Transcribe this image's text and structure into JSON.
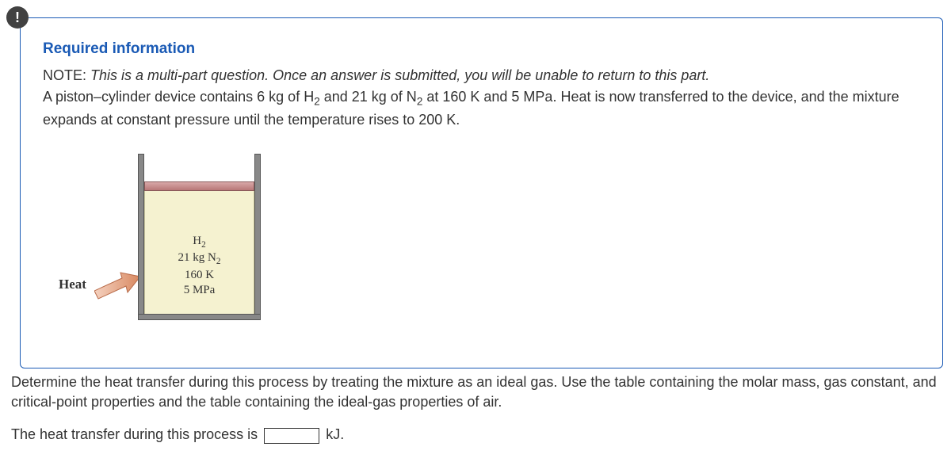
{
  "alert_icon": "!",
  "required_title": "Required information",
  "note_label": "NOTE:",
  "note_text": "This is a multi-part question. Once an answer is submitted, you will be unable to return to this part.",
  "problem_text_pre": "A piston–cylinder device contains 6 kg of H",
  "problem_text_sub1": "2",
  "problem_text_mid1": " and 21 kg of N",
  "problem_text_sub2": "2",
  "problem_text_mid2": " at 160 K and 5 MPa. Heat is now transferred to the device, and the mixture expands at constant pressure until the temperature rises to 200 K.",
  "diagram": {
    "heat_label": "Heat",
    "gas_h2": "H",
    "gas_h2_sub": "2",
    "gas_n2_line_pre": "21 kg N",
    "gas_n2_sub": "2",
    "gas_temp": "160 K",
    "gas_pressure": "5 MPa"
  },
  "question_text": "Determine the heat transfer during this process by treating the mixture as an ideal gas. Use the table containing the molar mass, gas constant, and critical-point properties and the table containing the ideal-gas properties of air.",
  "answer_prompt": "The heat transfer during this process is",
  "answer_unit": "kJ.",
  "answer_value": ""
}
